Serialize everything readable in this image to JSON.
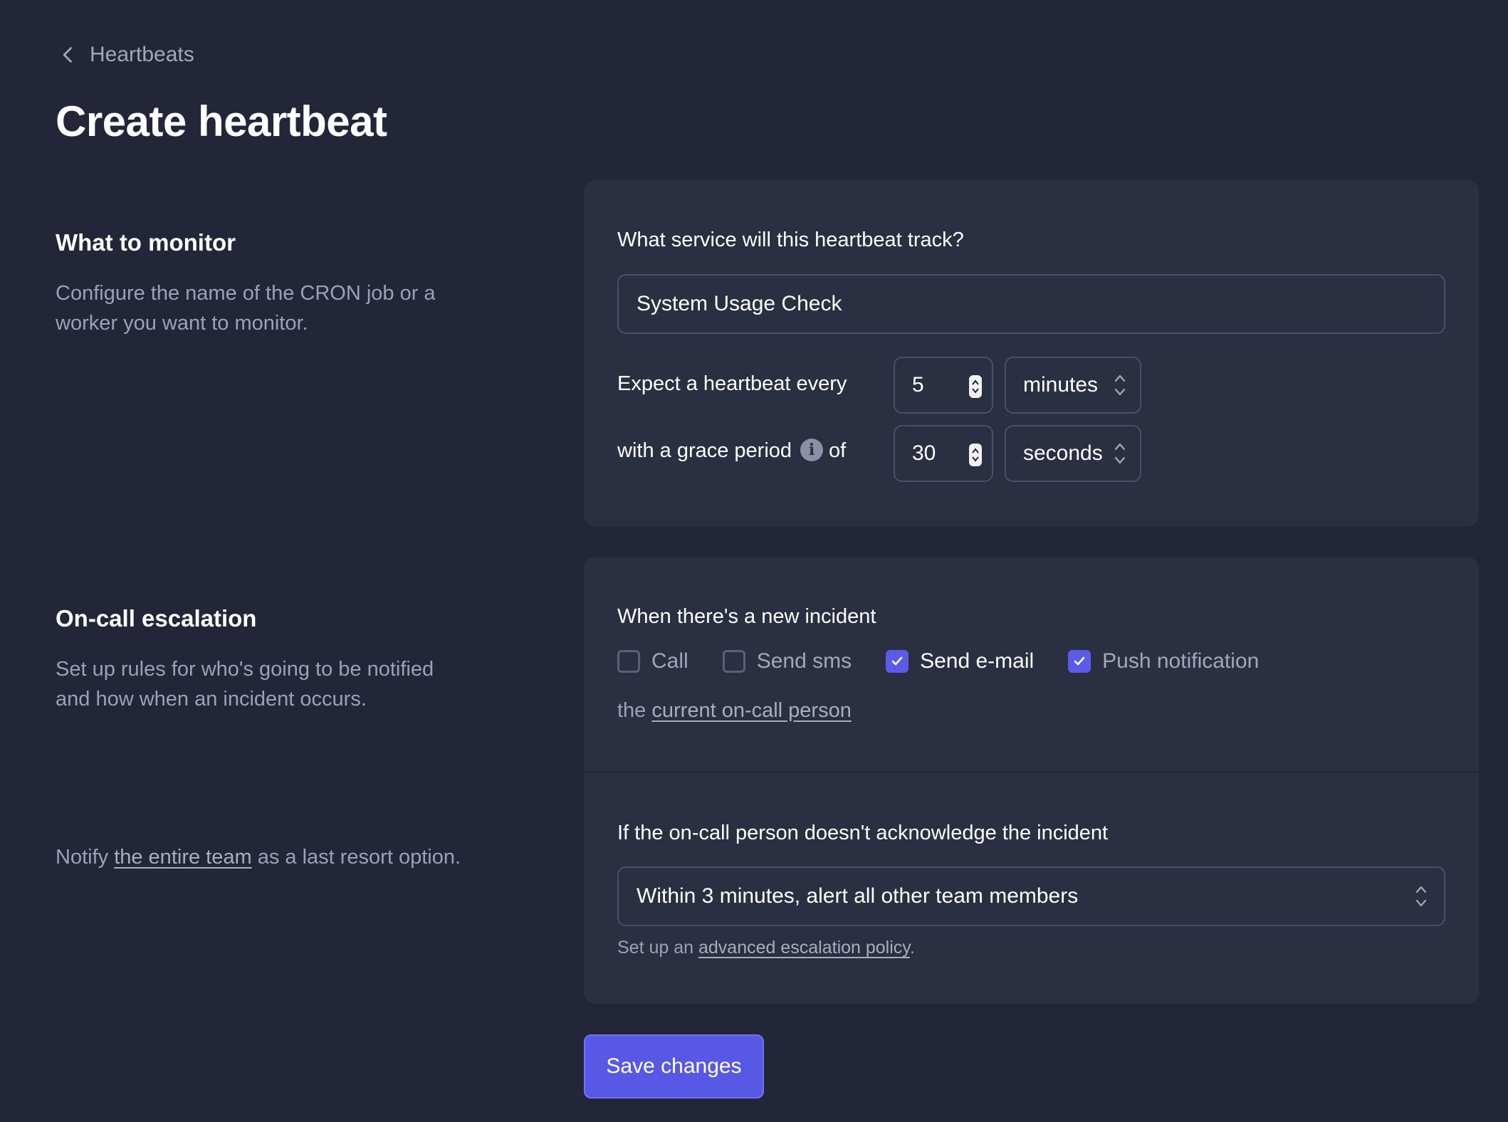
{
  "breadcrumb": {
    "label": "Heartbeats"
  },
  "page": {
    "title": "Create heartbeat"
  },
  "monitor": {
    "heading": "What to monitor",
    "description": "Configure the name of the CRON job or a worker you want to monitor.",
    "service_question": "What service will this heartbeat track?",
    "service_value": "System Usage Check",
    "expect_label": "Expect a heartbeat every",
    "period_value": "5",
    "period_unit": "minutes",
    "grace_label_pre": "with a grace period",
    "grace_label_post": "of",
    "grace_value": "30",
    "grace_unit": "seconds"
  },
  "escalation": {
    "heading": "On-call escalation",
    "description": "Set up rules for who's going to be notified and how when an incident occurs.",
    "last_resort_pre": "Notify ",
    "last_resort_link": "the entire team",
    "last_resort_post": " as a last resort option.",
    "incident_label": "When there's a new incident",
    "channels": [
      {
        "label": "Call",
        "checked": false
      },
      {
        "label": "Send sms",
        "checked": false
      },
      {
        "label": "Send e-mail",
        "checked": true
      },
      {
        "label": "Push notification",
        "checked": true
      }
    ],
    "target_pre": "the ",
    "target_link": "current on-call person",
    "ack_label": "If the on-call person doesn't acknowledge the incident",
    "ack_value": "Within 3 minutes, alert all other team members",
    "advanced_pre": "Set up an ",
    "advanced_link": "advanced escalation policy",
    "advanced_post": "."
  },
  "actions": {
    "save_label": "Save changes"
  },
  "colors": {
    "accent": "#5858e6",
    "background": "#222638",
    "card": "#2a2f42"
  }
}
